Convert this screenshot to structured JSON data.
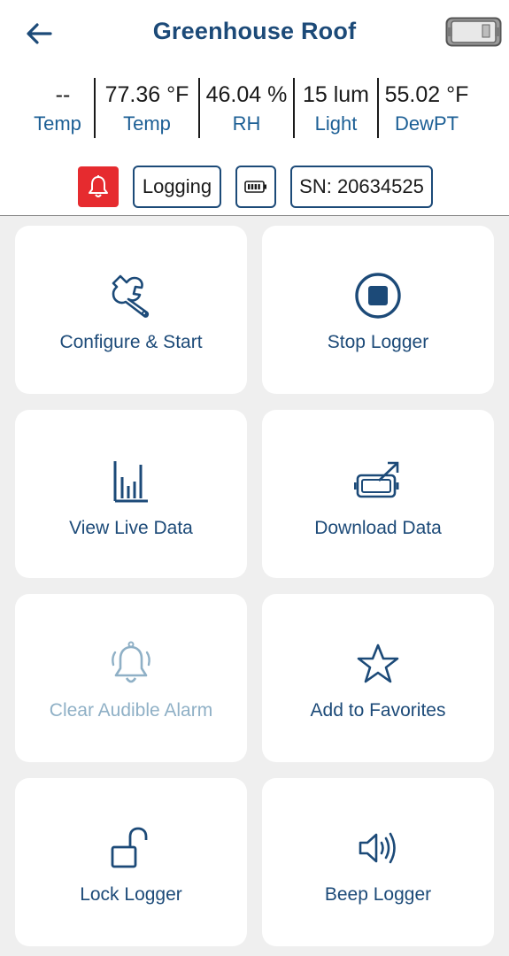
{
  "header": {
    "title": "Greenhouse Roof",
    "back_icon": "arrow-left-icon",
    "device_icon": "logger-device-icon"
  },
  "readings": [
    {
      "value": "--",
      "label": "Temp"
    },
    {
      "value": "77.36 °F",
      "label": "Temp"
    },
    {
      "value": "46.04 %",
      "label": "RH"
    },
    {
      "value": "15 lum",
      "label": "Light"
    },
    {
      "value": "55.02 °F",
      "label": "DewPT"
    }
  ],
  "status": {
    "alarm_icon": "bell-icon",
    "alarm_color": "#e62b2f",
    "logging_label": "Logging",
    "battery_icon": "battery-icon",
    "serial_label": "SN: 20634525"
  },
  "actions": [
    {
      "label": "Configure & Start",
      "icon": "wrench-icon",
      "enabled": true
    },
    {
      "label": "Stop Logger",
      "icon": "stop-icon",
      "enabled": true
    },
    {
      "label": "View Live Data",
      "icon": "bar-chart-icon",
      "enabled": true
    },
    {
      "label": "Download Data",
      "icon": "download-device-icon",
      "enabled": true
    },
    {
      "label": "Clear Audible Alarm",
      "icon": "ringing-bell-icon",
      "enabled": false
    },
    {
      "label": "Add to Favorites",
      "icon": "star-icon",
      "enabled": true
    },
    {
      "label": "Lock Logger",
      "icon": "unlocked-padlock-icon",
      "enabled": true
    },
    {
      "label": "Beep Logger",
      "icon": "speaker-icon",
      "enabled": true
    }
  ],
  "colors": {
    "brand": "#1c4a78",
    "label_blue": "#1c5f95",
    "disabled": "#8fb0c6",
    "background": "#efefef"
  }
}
